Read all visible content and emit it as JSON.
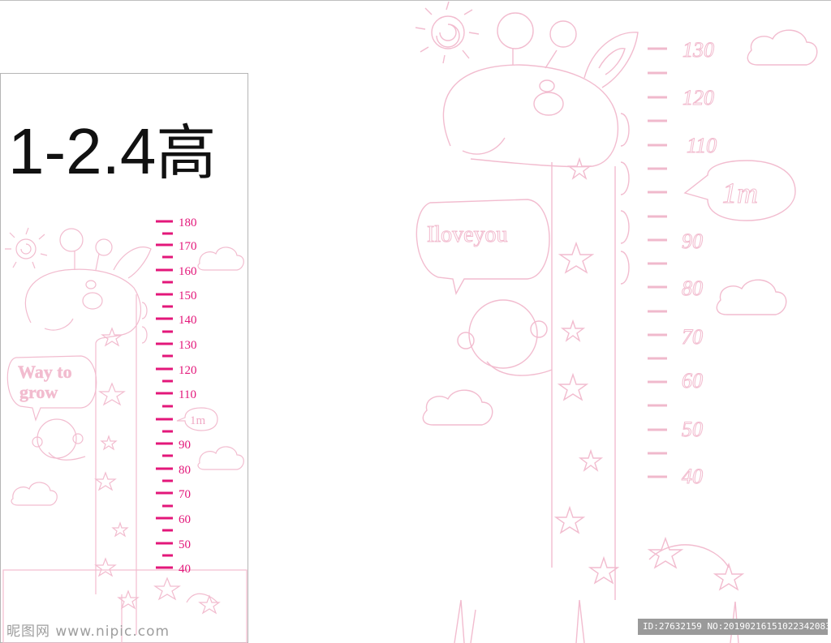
{
  "title": {
    "main": "1-2.4",
    "cjk": "高"
  },
  "left_chart": {
    "labels": [
      "180",
      "170",
      "160",
      "150",
      "140",
      "130",
      "120",
      "110",
      "1m",
      "90",
      "80",
      "70",
      "60",
      "50",
      "40"
    ],
    "bubble_text": [
      "Way to",
      "grow"
    ],
    "tick_color": "#e3177a"
  },
  "right_chart": {
    "labels": [
      "130",
      "120",
      "110",
      "1m",
      "90",
      "80",
      "70",
      "60",
      "50",
      "40"
    ],
    "bubble_text": "Iloveyou",
    "line_color": "#f0b9cc"
  },
  "watermark": {
    "left": "昵图网 www.nipic.com",
    "right": "ID:27632159 NO:20190216151022342083"
  }
}
